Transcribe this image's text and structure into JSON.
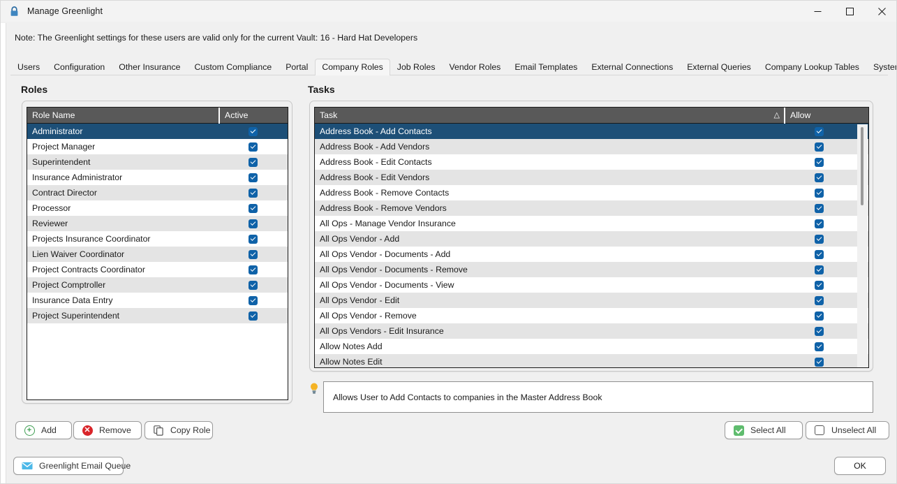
{
  "window": {
    "title": "Manage Greenlight",
    "icon": "lock-icon",
    "minimize_label": "—",
    "maximize_label": "□",
    "close_label": "✕"
  },
  "note": "Note:  The Greenlight settings for these users are valid only for the current Vault: 16 - Hard Hat Developers",
  "tabs": [
    {
      "label": "Users",
      "active": false
    },
    {
      "label": "Configuration",
      "active": false
    },
    {
      "label": "Other Insurance",
      "active": false
    },
    {
      "label": "Custom Compliance",
      "active": false
    },
    {
      "label": "Portal",
      "active": false
    },
    {
      "label": "Company Roles",
      "active": true
    },
    {
      "label": "Job Roles",
      "active": false
    },
    {
      "label": "Vendor Roles",
      "active": false
    },
    {
      "label": "Email Templates",
      "active": false
    },
    {
      "label": "External Connections",
      "active": false
    },
    {
      "label": "External Queries",
      "active": false
    },
    {
      "label": "Company Lookup Tables",
      "active": false
    },
    {
      "label": "System Lookup Tables",
      "active": false
    }
  ],
  "roles": {
    "heading": "Roles",
    "columns": {
      "name": "Role Name",
      "active": "Active"
    },
    "rows": [
      {
        "name": "Administrator",
        "active": true,
        "selected": true
      },
      {
        "name": "Project Manager",
        "active": true,
        "selected": false
      },
      {
        "name": "Superintendent",
        "active": true,
        "selected": false
      },
      {
        "name": "Insurance Administrator",
        "active": true,
        "selected": false
      },
      {
        "name": "Contract Director",
        "active": true,
        "selected": false
      },
      {
        "name": "Processor",
        "active": true,
        "selected": false
      },
      {
        "name": "Reviewer",
        "active": true,
        "selected": false
      },
      {
        "name": "Projects Insurance Coordinator",
        "active": true,
        "selected": false
      },
      {
        "name": "Lien Waiver Coordinator",
        "active": true,
        "selected": false
      },
      {
        "name": "Project Contracts Coordinator",
        "active": true,
        "selected": false
      },
      {
        "name": "Project Comptroller",
        "active": true,
        "selected": false
      },
      {
        "name": "Insurance Data Entry",
        "active": true,
        "selected": false
      },
      {
        "name": "Project Superintendent",
        "active": true,
        "selected": false
      }
    ]
  },
  "tasks": {
    "heading": "Tasks",
    "columns": {
      "task": "Task",
      "allow": "Allow"
    },
    "sort_indicator": "△",
    "rows": [
      {
        "name": "Address Book - Add Contacts",
        "allow": true,
        "selected": true
      },
      {
        "name": "Address Book - Add Vendors",
        "allow": true,
        "selected": false
      },
      {
        "name": "Address Book - Edit Contacts",
        "allow": true,
        "selected": false
      },
      {
        "name": "Address Book - Edit Vendors",
        "allow": true,
        "selected": false
      },
      {
        "name": "Address Book - Remove Contacts",
        "allow": true,
        "selected": false
      },
      {
        "name": "Address Book - Remove Vendors",
        "allow": true,
        "selected": false
      },
      {
        "name": "All Ops - Manage Vendor Insurance",
        "allow": true,
        "selected": false
      },
      {
        "name": "All Ops Vendor - Add",
        "allow": true,
        "selected": false
      },
      {
        "name": "All Ops Vendor - Documents - Add",
        "allow": true,
        "selected": false
      },
      {
        "name": "All Ops Vendor - Documents - Remove",
        "allow": true,
        "selected": false
      },
      {
        "name": "All Ops Vendor - Documents - View",
        "allow": true,
        "selected": false
      },
      {
        "name": "All Ops Vendor - Edit",
        "allow": true,
        "selected": false
      },
      {
        "name": "All Ops Vendor - Remove",
        "allow": true,
        "selected": false
      },
      {
        "name": "All Ops Vendors - Edit Insurance",
        "allow": true,
        "selected": false
      },
      {
        "name": "Allow Notes Add",
        "allow": true,
        "selected": false
      },
      {
        "name": "Allow Notes Edit",
        "allow": true,
        "selected": false
      }
    ]
  },
  "description": {
    "icon": "lightbulb-icon",
    "text": "Allows User to Add Contacts to companies in the Master Address Book"
  },
  "buttons": {
    "add": {
      "label": "Add",
      "icon": "circle-plus-icon"
    },
    "remove": {
      "label": "Remove",
      "icon": "circle-x-icon"
    },
    "copy_role": {
      "label": "Copy Role",
      "icon": "copy-icon"
    },
    "select_all": {
      "label": "Select All",
      "icon": "checked-checkbox-icon"
    },
    "unselect_all": {
      "label": "Unselect All",
      "icon": "empty-checkbox-icon"
    },
    "email_queue": {
      "label": "Greenlight Email Queue",
      "icon": "envelope-icon"
    },
    "ok": {
      "label": "OK"
    }
  },
  "colors": {
    "accent_selection": "#1d4f77",
    "header_gray": "#595959",
    "checkbox_blue": "#0f62a8",
    "green": "#5fbc6e",
    "red": "#d9252a"
  }
}
